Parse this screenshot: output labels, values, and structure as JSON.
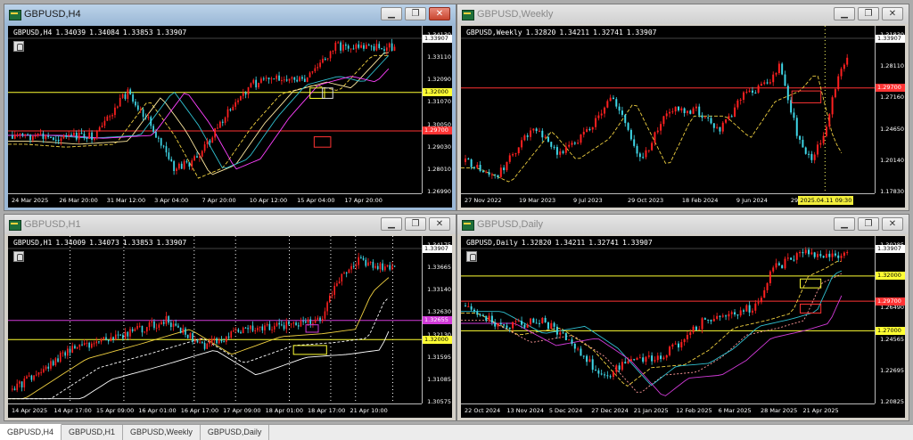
{
  "colors": {
    "bull": "#ff2020",
    "bear": "#3fd7e8",
    "yellow_level": "#ffff33",
    "red_level": "#ff3333",
    "magenta_level": "#d13ad8"
  },
  "icons": {
    "app": "chart-window-icon",
    "minimize": "minimize-icon",
    "restore": "restore-icon",
    "close": "close-icon",
    "one_click": "one-click-trading-icon"
  },
  "tabs": [
    {
      "label": "GBPUSD,H4",
      "active": true
    },
    {
      "label": "GBPUSD,H1",
      "active": false
    },
    {
      "label": "GBPUSD,Weekly",
      "active": false
    },
    {
      "label": "GBPUSD,Daily",
      "active": false
    }
  ],
  "windows": [
    {
      "title": "GBPUSD,H4",
      "active": true,
      "info": {
        "symbol": "GBPUSD,H4",
        "open": "1.34039",
        "high": "1.34084",
        "low": "1.33853",
        "close": "1.33907"
      },
      "price_labels": [
        "1.34130",
        "1.33110",
        "1.32090",
        "1.31070",
        "1.30050",
        "1.29030",
        "1.28010",
        "1.26990"
      ],
      "current_price": "1.33907",
      "level_tags": [
        {
          "text": "1.32000",
          "kind": "yellow"
        },
        {
          "text": "1.29700",
          "kind": "red"
        }
      ],
      "time_labels": [
        "24 Mar 2025",
        "26 Mar 20:00",
        "31 Mar 12:00",
        "3 Apr 04:00",
        "7 Apr 20:00",
        "10 Apr 12:00",
        "15 Apr 04:00",
        "17 Apr 20:00"
      ]
    },
    {
      "title": "GBPUSD,Weekly",
      "active": false,
      "info": {
        "symbol": "GBPUSD,Weekly",
        "open": "1.32820",
        "high": "1.34211",
        "low": "1.32741",
        "close": "1.33907"
      },
      "price_labels": [
        "1.31830",
        "1.28110",
        "1.27160",
        "1.24650",
        "1.20140",
        "1.17830"
      ],
      "current_price": "1.33907",
      "level_tags": [
        {
          "text": "1.29700",
          "kind": "red"
        }
      ],
      "time_labels": [
        "27 Nov 2022",
        "19 Mar 2023",
        "9 Jul 2023",
        "29 Oct 2023",
        "18 Feb 2024",
        "9 Jun 2024",
        "29 Sep 2024"
      ],
      "time_badge": "2025.04.11 09:30"
    },
    {
      "title": "GBPUSD,H1",
      "active": false,
      "info": {
        "symbol": "GBPUSD,H1",
        "open": "1.34009",
        "high": "1.34073",
        "low": "1.33853",
        "close": "1.33907"
      },
      "price_labels": [
        "1.34175",
        "1.33665",
        "1.33140",
        "1.32630",
        "1.32130",
        "1.31595",
        "1.31085",
        "1.30575"
      ],
      "current_price": "1.33907",
      "level_tags": [
        {
          "text": "1.32655",
          "kind": "magenta"
        },
        {
          "text": "1.32000",
          "kind": "yellow"
        }
      ],
      "time_labels": [
        "14 Apr 2025",
        "14 Apr 17:00",
        "15 Apr 09:00",
        "16 Apr 01:00",
        "16 Apr 17:00",
        "17 Apr 09:00",
        "18 Apr 01:00",
        "18 Apr 17:00",
        "21 Apr 10:00"
      ]
    },
    {
      "title": "GBPUSD,Daily",
      "active": false,
      "info": {
        "symbol": "GBPUSD,Daily",
        "open": "1.32820",
        "high": "1.34211",
        "low": "1.32741",
        "close": "1.33907"
      },
      "price_labels": [
        "1.30285",
        "1.28360",
        "1.26490",
        "1.24565",
        "1.22695",
        "1.20825"
      ],
      "current_price": "1.33907",
      "level_tags": [
        {
          "text": "1.32000",
          "kind": "yellow"
        },
        {
          "text": "1.29700",
          "kind": "red"
        },
        {
          "text": "1.27000",
          "kind": "yellow"
        }
      ],
      "time_labels": [
        "22 Oct 2024",
        "13 Nov 2024",
        "5 Dec 2024",
        "27 Dec 2024",
        "21 Jan 2025",
        "12 Feb 2025",
        "6 Mar 2025",
        "28 Mar 2025",
        "21 Apr 2025"
      ]
    }
  ]
}
